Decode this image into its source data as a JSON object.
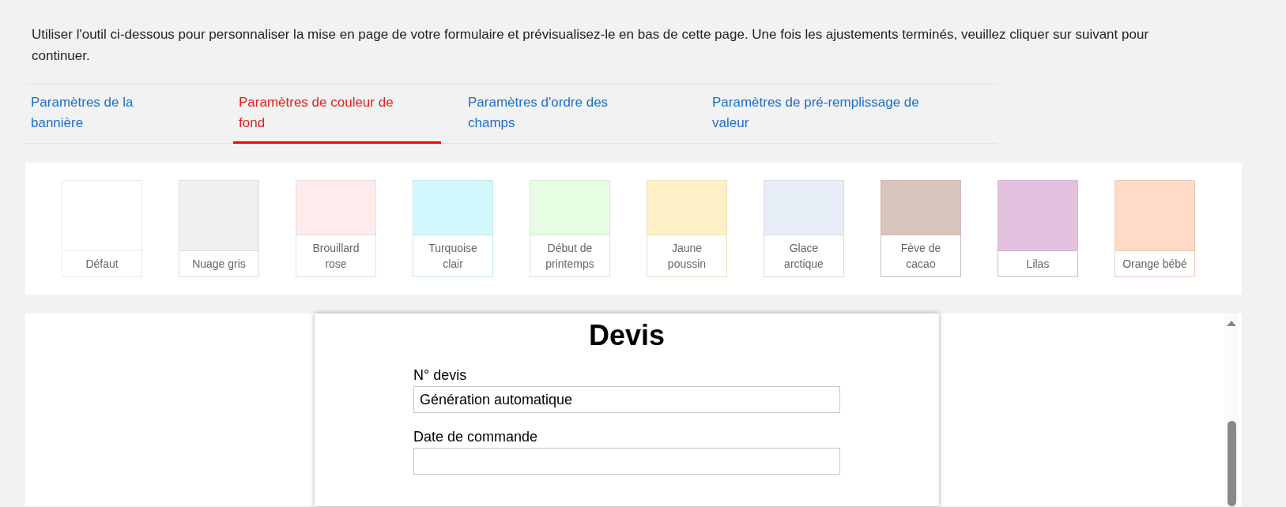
{
  "intro": "Utiliser l'outil ci-dessous pour personnaliser la mise en page de votre formulaire et prévisualisez-le en bas de cette page. Une fois les ajustements terminés, veuillez cliquer sur suivant pour continuer.",
  "tabs": [
    {
      "label": "Paramètres de la bannière",
      "selected": false
    },
    {
      "label": "Paramètres de couleur de fond",
      "selected": true
    },
    {
      "label": "Paramètres d'ordre des champs",
      "selected": false
    },
    {
      "label": "Paramètres de pré-remplissage de valeur",
      "selected": false
    }
  ],
  "swatches": [
    {
      "label": "Défaut",
      "color": "#ffffff"
    },
    {
      "label": "Nuage gris",
      "color": "#f0f0f0"
    },
    {
      "label": "Brouillard rose",
      "color": "#fdeceb"
    },
    {
      "label": "Turquoise clair",
      "color": "#d2f8fd"
    },
    {
      "label": "Début de printemps",
      "color": "#e6fde3"
    },
    {
      "label": "Jaune poussin",
      "color": "#fff0c8"
    },
    {
      "label": "Glace arctique",
      "color": "#e6edf7"
    },
    {
      "label": "Fève de cacao",
      "color": "#d9c4bb"
    },
    {
      "label": "Lilas",
      "color": "#e2c2df"
    },
    {
      "label": "Orange bébé",
      "color": "#fedac7"
    }
  ],
  "preview": {
    "title": "Devis",
    "fields": [
      {
        "label": "N° devis",
        "value": "Génération automatique"
      },
      {
        "label": "Date de commande"
      }
    ]
  }
}
